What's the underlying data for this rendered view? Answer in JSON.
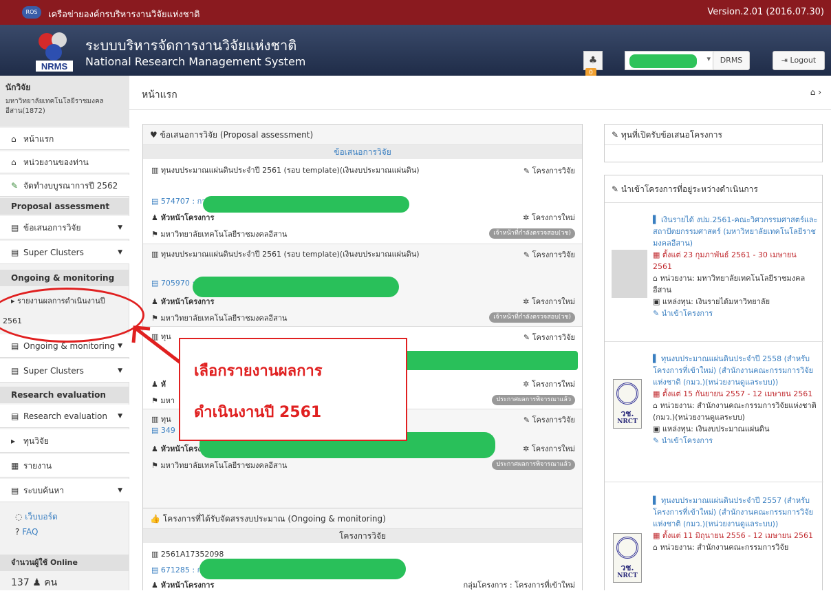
{
  "topbar": {
    "org": "เครือข่ายองค์กรบริหารงานวิจัยแห่งชาติ",
    "logo_text": "ROS",
    "version": "Version.2.01 (2016.07.30)"
  },
  "header": {
    "title_th": "ระบบบริหารจัดการงานวิจัยแห่งชาติ",
    "title_en": "National Research Management System",
    "logo_text": "NRMS",
    "notif_count": "0",
    "drms": "DRMS",
    "logout": "Logout"
  },
  "sidebar": {
    "role": "นักวิจัย",
    "univ": "มหาวิทยาลัยเทคโนโลยีราชมงคลอีสาน(1872)",
    "items": [
      "หน้าแรก",
      "หน่วยงานของท่าน",
      "จัดทำงบบูรณาการปี 2562"
    ],
    "sec1": "Proposal assessment",
    "sec1_items": [
      "ข้อเสนอการวิจัย",
      "Super Clusters"
    ],
    "sec2": "Ongoing & monitoring",
    "report_link": "รายงานผลการดำเนินงานปี",
    "report_year": "2561",
    "sec2_items": [
      "Ongoing & monitoring",
      "Super Clusters"
    ],
    "sec3": "Research evaluation",
    "sec3_items": [
      "Research evaluation",
      "ทุนวิจัย",
      "รายงาน",
      "ระบบค้นหา"
    ],
    "webboard": "เว็บบอร์ด",
    "faq": "FAQ",
    "online_label": "จำนวนผู้ใช้ Online",
    "online_count": "137",
    "online_unit": "คน"
  },
  "annotation": {
    "line1": "เลือกรายงานผลการ",
    "line2": "ดำเนินงานปี 2561"
  },
  "breadcrumb": {
    "title": "หน้าแรก"
  },
  "proposal_panel": {
    "title": "ข้อเสนอการวิจัย (Proposal assessment)",
    "subheader": "ข้อเสนอการวิจัย",
    "rows": [
      {
        "fund": "ทุนงบประมาณแผ่นดินประจำปี 2561 (รอบ template)(เงินงบประมาณแผ่นดิน)",
        "kind": "โครงการวิจัย",
        "code": "574707 : การ",
        "head": "หัวหน้าโครงการ",
        "newp": "โครงการใหม่",
        "uni": "มหาวิทยาลัยเทคโนโลยีราชมงคลอีสาน",
        "status": "เจ้าหน้าที่กำลังตรวจสอบ(วช)"
      },
      {
        "fund": "ทุนงบประมาณแผ่นดินประจำปี 2561 (รอบ template)(เงินงบประมาณแผ่นดิน)",
        "kind": "โครงการวิจัย",
        "code": "705970 :",
        "head": "หัวหน้าโครงการ",
        "newp": "โครงการใหม่",
        "uni": "มหาวิทยาลัยเทคโนโลยีราชมงคลอีสาน",
        "status": "เจ้าหน้าที่กำลังตรวจสอบ(วช)"
      },
      {
        "fund": "ทุน",
        "kind": "โครงการวิจัย",
        "code": "",
        "head": "หั",
        "newp": "โครงการใหม่",
        "uni": "มหา",
        "status": "ประกาศผลการพิจารณาแล้ว"
      },
      {
        "fund": "ทุน",
        "kind": "โครงการวิจัย",
        "code": "349",
        "head": "หัวหน้าโครงการ",
        "newp": "โครงการใหม่",
        "uni": "มหาวิทยาลัยเทคโนโลยีราชมงคลอีสาน",
        "status": "ประกาศผลการพิจารณาแล้ว"
      }
    ]
  },
  "ongoing_panel": {
    "title": "โครงการที่ได้รับจัดสรรงบประมาณ (Ongoing & monitoring)",
    "subheader": "โครงการวิจัย",
    "fund": "2561A17352098",
    "code": "671285 : ก",
    "head": "หัวหน้าโครงการ",
    "group": "กลุ่มโครงการ : โครงการที่เข้าใหม่"
  },
  "right_panel1": {
    "title": "ทุนที่เปิดรับข้อเสนอโครงการ"
  },
  "right_panel2": {
    "title": "นำเข้าโครงการที่อยู่ระหว่างดำเนินการ",
    "items": [
      {
        "name": "เงินรายได้ งปม.2561-คณะวิศวกรรมศาสตร์และสถาปัตยกรรมศาสตร์ (มหาวิทยาลัยเทคโนโลยีราชมงคลอีสาน)",
        "date": "ตั้งแต่ 23 กุมภาพันธ์ 2561 - 30 เมษายน 2561",
        "unit": "หน่วยงาน: มหาวิทยาลัยเทคโนโลยีราชมงคลอีสาน",
        "source": "แหล่งทุน: เงินรายได้มหาวิทยาลัย",
        "action": "นำเข้าโครงการ"
      },
      {
        "name": "ทุนงบประมาณแผ่นดินประจำปี 2558 (สำหรับโครงการที่เข้าใหม่) (สำนักงานคณะกรรมการวิจัยแห่งชาติ (กมว.)(หน่วยงานดูแลระบบ))",
        "date": "ตั้งแต่ 15 กันยายน 2557 - 12 เมษายน 2561",
        "unit": "หน่วยงาน: สำนักงานคณะกรรมการวิจัยแห่งชาติ (กมว.)(หน่วยงานดูแลระบบ)",
        "source": "แหล่งทุน: เงินงบประมาณแผ่นดิน",
        "action": "นำเข้าโครงการ"
      },
      {
        "name": "ทุนงบประมาณแผ่นดินประจำปี 2557 (สำหรับโครงการที่เข้าใหม่) (สำนักงานคณะกรรมการวิจัยแห่งชาติ (กมว.)(หน่วยงานดูแลระบบ))",
        "date": "ตั้งแต่ 11 มิถุนายน 2556 - 12 เมษายน 2561",
        "unit": "หน่วยงาน: สำนักงานคณะกรรมการวิจัย",
        "source": "",
        "action": ""
      }
    ],
    "seal_t1": "วช.",
    "seal_t2": "NRCT"
  }
}
